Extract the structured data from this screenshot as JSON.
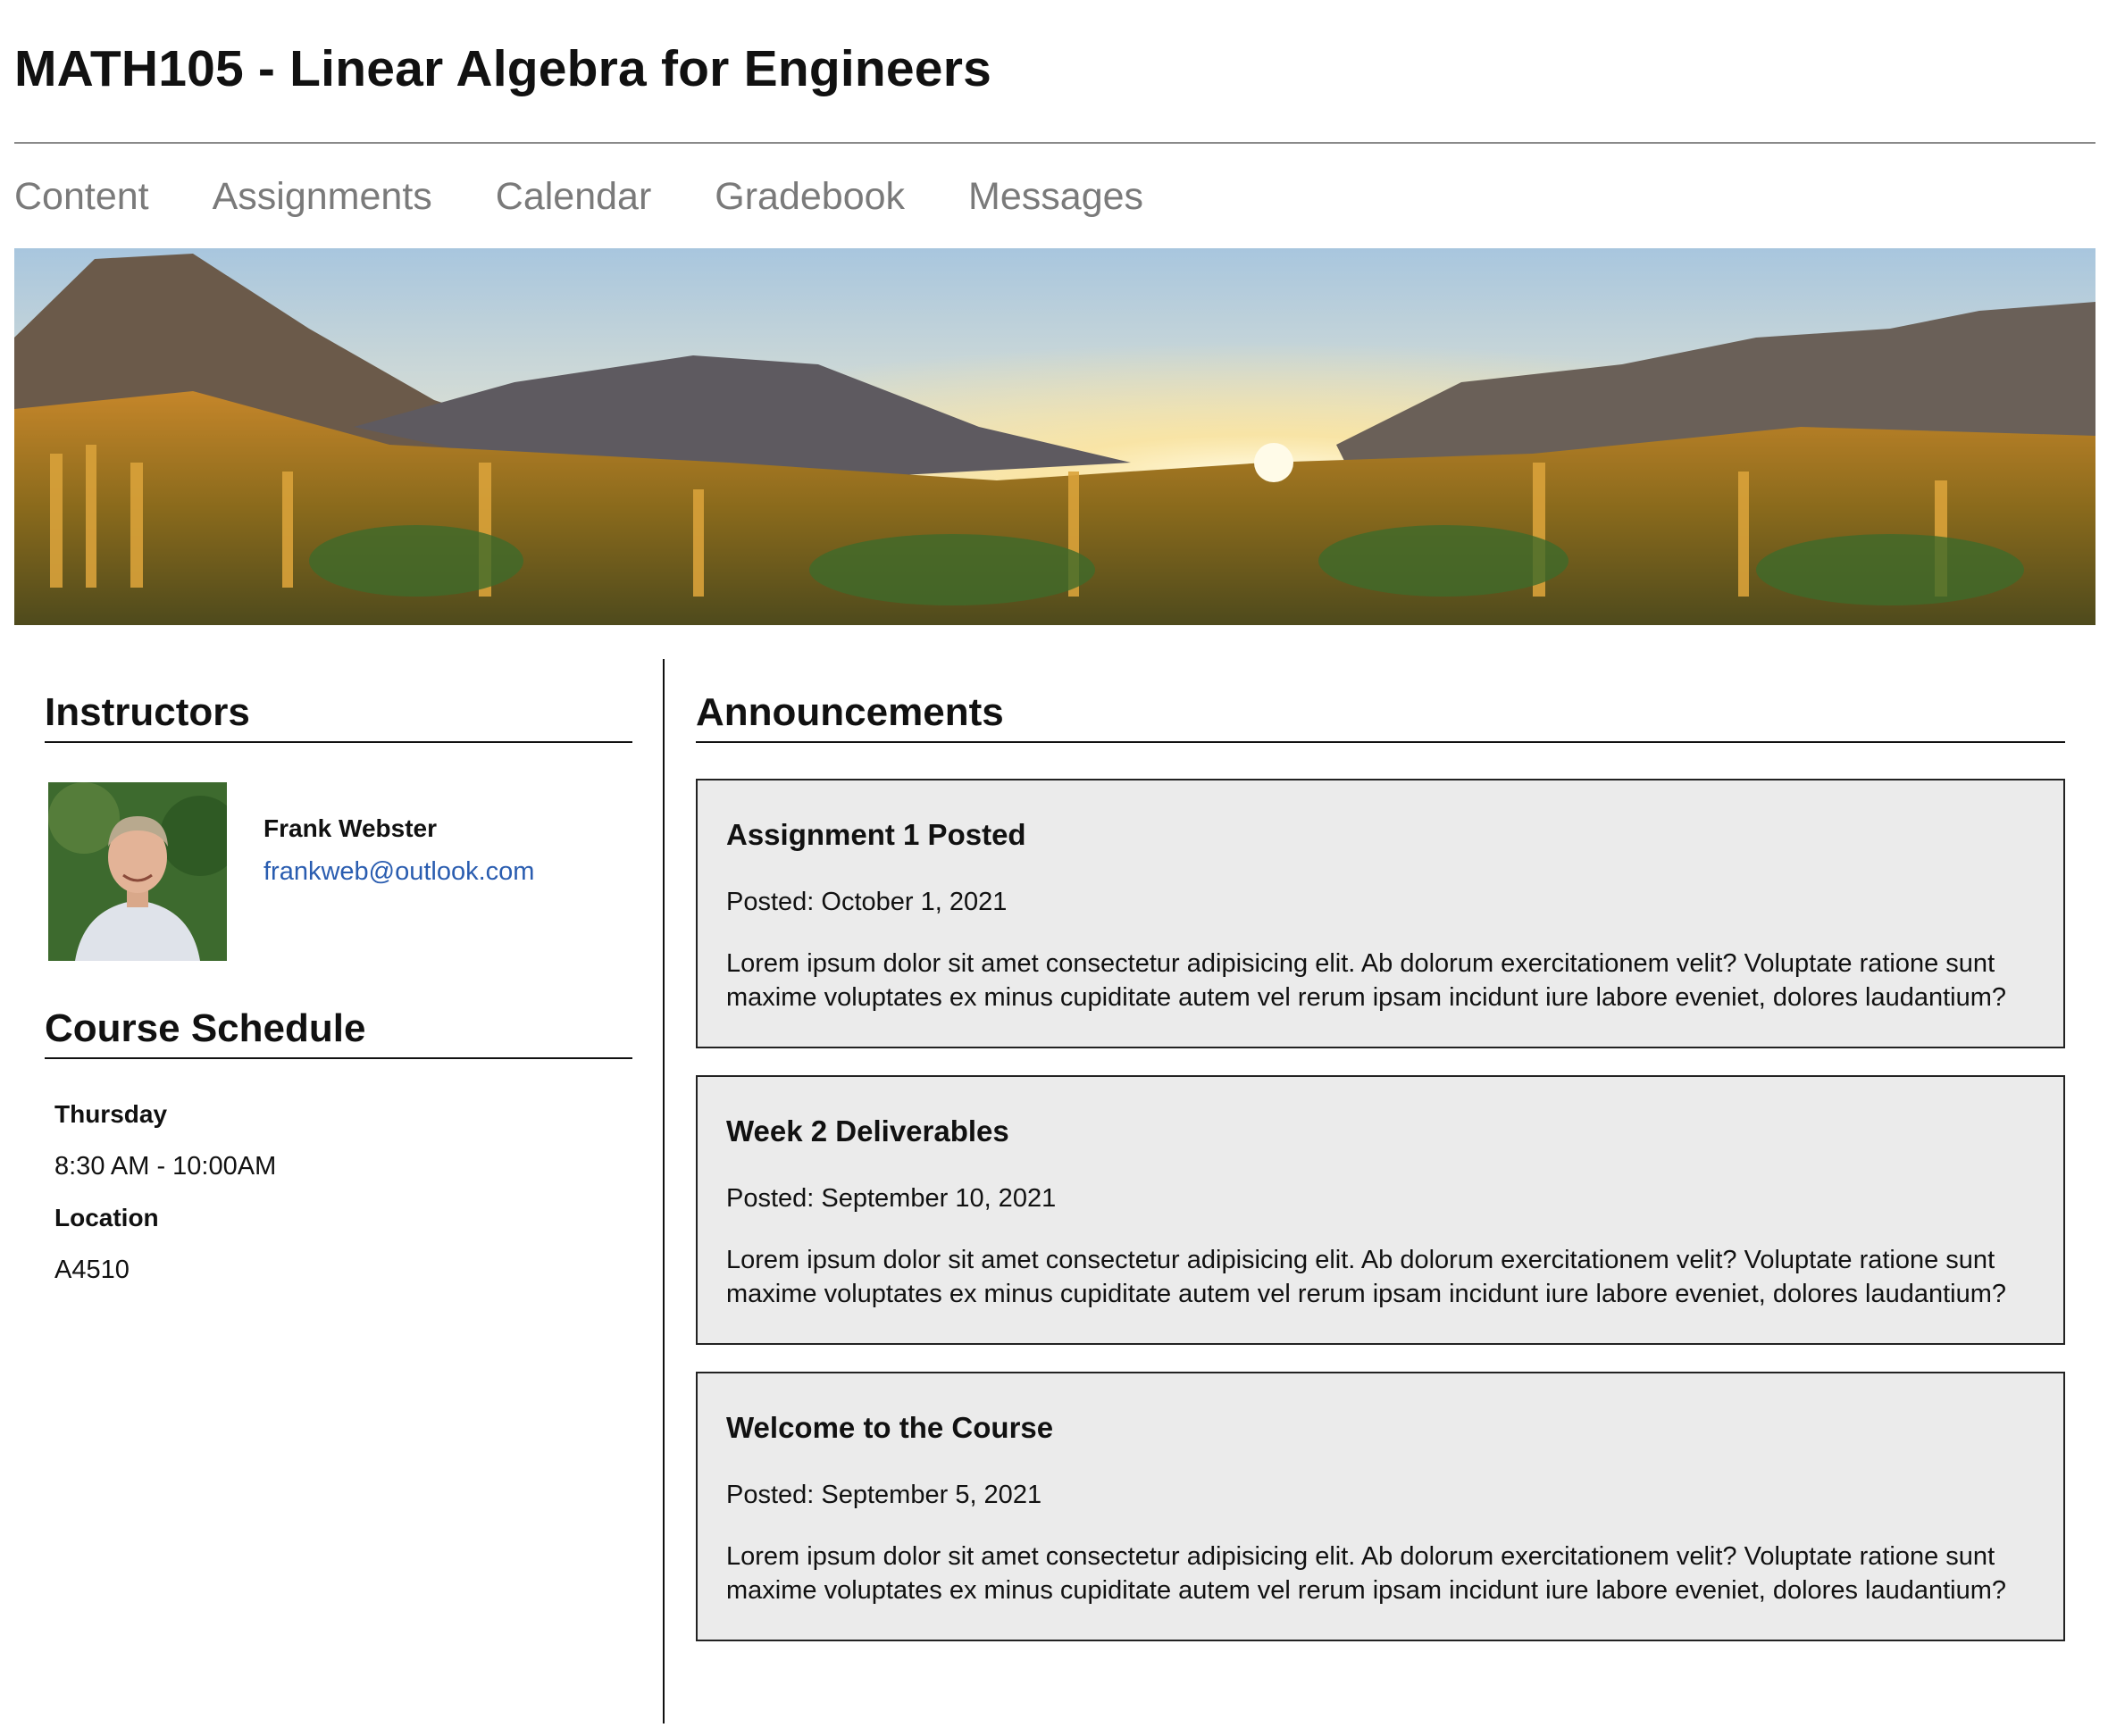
{
  "header": {
    "title": "MATH105 - Linear Algebra for Engineers"
  },
  "nav": {
    "items": [
      "Content",
      "Assignments",
      "Calendar",
      "Gradebook",
      "Messages"
    ]
  },
  "instructors": {
    "heading": "Instructors",
    "name": "Frank Webster",
    "email": "frankweb@outlook.com"
  },
  "schedule": {
    "heading": "Course Schedule",
    "day_label": "Thursday",
    "time": "8:30 AM - 10:00AM",
    "location_label": "Location",
    "location": "A4510"
  },
  "announcements": {
    "heading": "Announcements",
    "items": [
      {
        "title": "Assignment 1 Posted",
        "date": "Posted: October 1, 2021",
        "body": "Lorem ipsum dolor sit amet consectetur adipisicing elit. Ab dolorum exercitationem velit? Voluptate ratione sunt maxime voluptates ex minus cupiditate autem vel rerum ipsam incidunt iure labore eveniet, dolores laudantium?"
      },
      {
        "title": "Week 2 Deliverables",
        "date": "Posted: September 10, 2021",
        "body": "Lorem ipsum dolor sit amet consectetur adipisicing elit. Ab dolorum exercitationem velit? Voluptate ratione sunt maxime voluptates ex minus cupiditate autem vel rerum ipsam incidunt iure labore eveniet, dolores laudantium?"
      },
      {
        "title": "Welcome to the Course",
        "date": "Posted: September 5, 2021",
        "body": "Lorem ipsum dolor sit amet consectetur adipisicing elit. Ab dolorum exercitationem velit? Voluptate ratione sunt maxime voluptates ex minus cupiditate autem vel rerum ipsam incidunt iure labore eveniet, dolores laudantium?"
      }
    ]
  },
  "colors": {
    "link": "#2a5db0",
    "nav_text": "#7a7a7a",
    "card_bg": "#ebebeb"
  }
}
